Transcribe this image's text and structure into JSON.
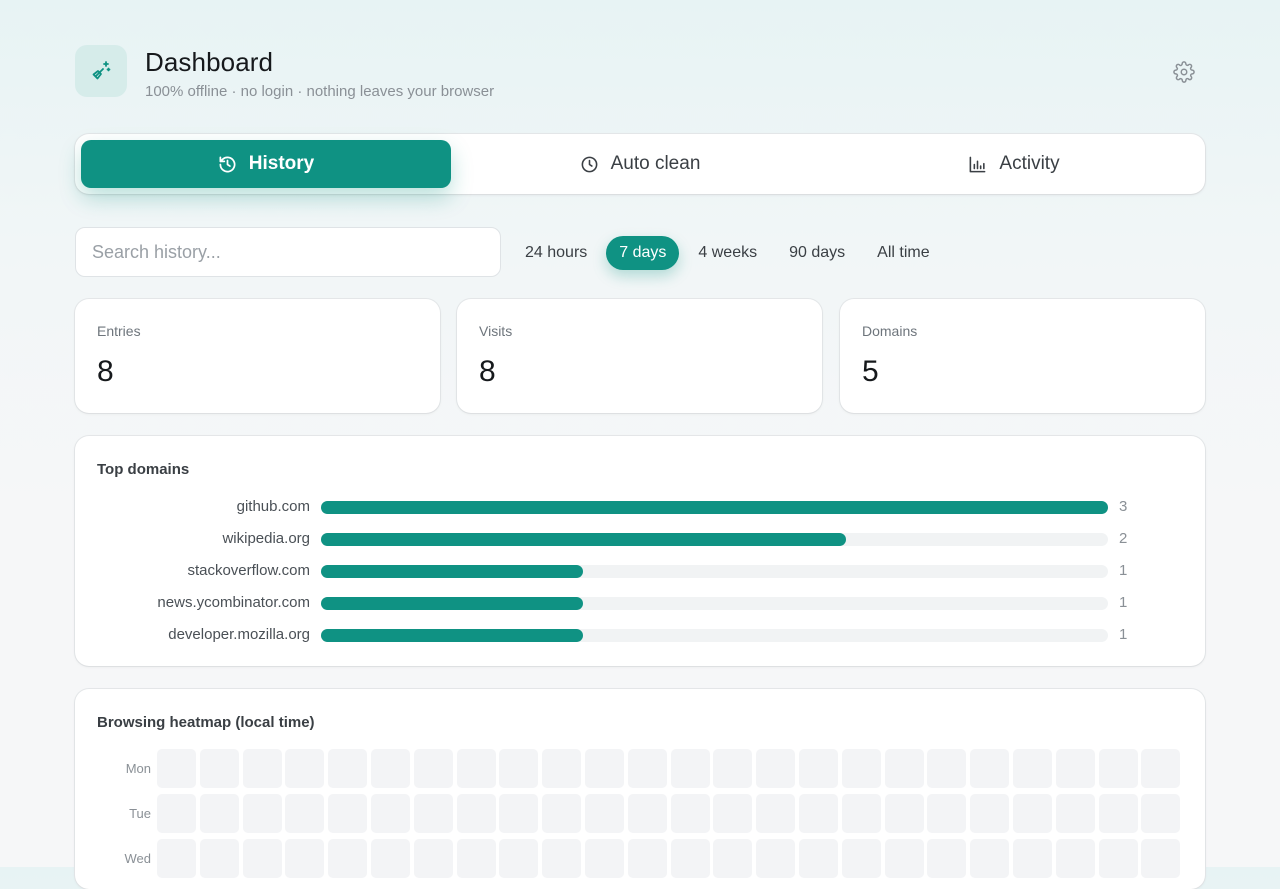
{
  "header": {
    "title": "Dashboard",
    "subtitle": "100% offline · no login · nothing leaves your browser",
    "logo_icon": "broom-sparkle-icon",
    "settings_icon": "gear-icon"
  },
  "tabs": [
    {
      "label": "History",
      "icon": "history-icon",
      "active": true
    },
    {
      "label": "Auto clean",
      "icon": "clock-icon",
      "active": false
    },
    {
      "label": "Activity",
      "icon": "bar-chart-icon",
      "active": false
    }
  ],
  "search": {
    "placeholder": "Search history...",
    "value": ""
  },
  "ranges": [
    {
      "label": "24 hours",
      "active": false
    },
    {
      "label": "7 days",
      "active": true
    },
    {
      "label": "4 weeks",
      "active": false
    },
    {
      "label": "90 days",
      "active": false
    },
    {
      "label": "All time",
      "active": false
    }
  ],
  "stats": [
    {
      "label": "Entries",
      "value": "8"
    },
    {
      "label": "Visits",
      "value": "8"
    },
    {
      "label": "Domains",
      "value": "5"
    }
  ],
  "top_domains": {
    "title": "Top domains",
    "max": 3,
    "items": [
      {
        "domain": "github.com",
        "count": 3
      },
      {
        "domain": "wikipedia.org",
        "count": 2
      },
      {
        "domain": "stackoverflow.com",
        "count": 1
      },
      {
        "domain": "news.ycombinator.com",
        "count": 1
      },
      {
        "domain": "developer.mozilla.org",
        "count": 1
      }
    ]
  },
  "heatmap": {
    "title": "Browsing heatmap (local time)",
    "days": [
      "Mon",
      "Tue",
      "Wed"
    ],
    "hour_columns": 24
  },
  "colors": {
    "accent": "#0f9283",
    "track": "#f1f3f4",
    "empty_cell": "#f3f4f6"
  }
}
